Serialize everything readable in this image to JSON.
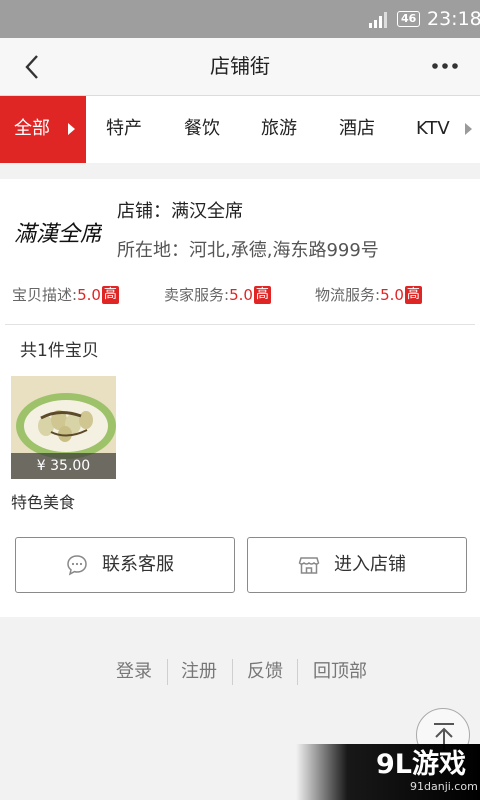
{
  "status_bar": {
    "network": "46",
    "time": "23:18"
  },
  "navbar": {
    "title": "店铺街"
  },
  "tabs": {
    "active": "全部",
    "items": [
      "特产",
      "餐饮",
      "旅游",
      "酒店",
      "KTV"
    ]
  },
  "shop": {
    "logo_text": "滿漢全席",
    "name": "店铺：满汉全席",
    "location": "所在地：河北,承德,海东路999号",
    "ratings": [
      {
        "label": "宝贝描述:",
        "value": "5.0",
        "badge": "高"
      },
      {
        "label": "卖家服务:",
        "value": "5.0",
        "badge": "高"
      },
      {
        "label": "物流服务:",
        "value": "5.0",
        "badge": "高"
      }
    ],
    "item_count": "共1件宝贝",
    "product": {
      "price": "¥ 35.00",
      "name": "特色美食"
    },
    "buttons": {
      "contact": "联系客服",
      "enter": "进入店铺"
    }
  },
  "footer": {
    "links": [
      "登录",
      "注册",
      "反馈",
      "回顶部"
    ]
  },
  "watermark": {
    "text": "9L游戏",
    "url": "91danji.com"
  },
  "colors": {
    "accent": "#e02525",
    "status_bar": "#9e9e9e",
    "background": "#f2f2f2"
  },
  "icons": [
    "back-icon",
    "more-icon",
    "signal-icon",
    "chat-icon",
    "store-icon",
    "scroll-top-icon"
  ]
}
